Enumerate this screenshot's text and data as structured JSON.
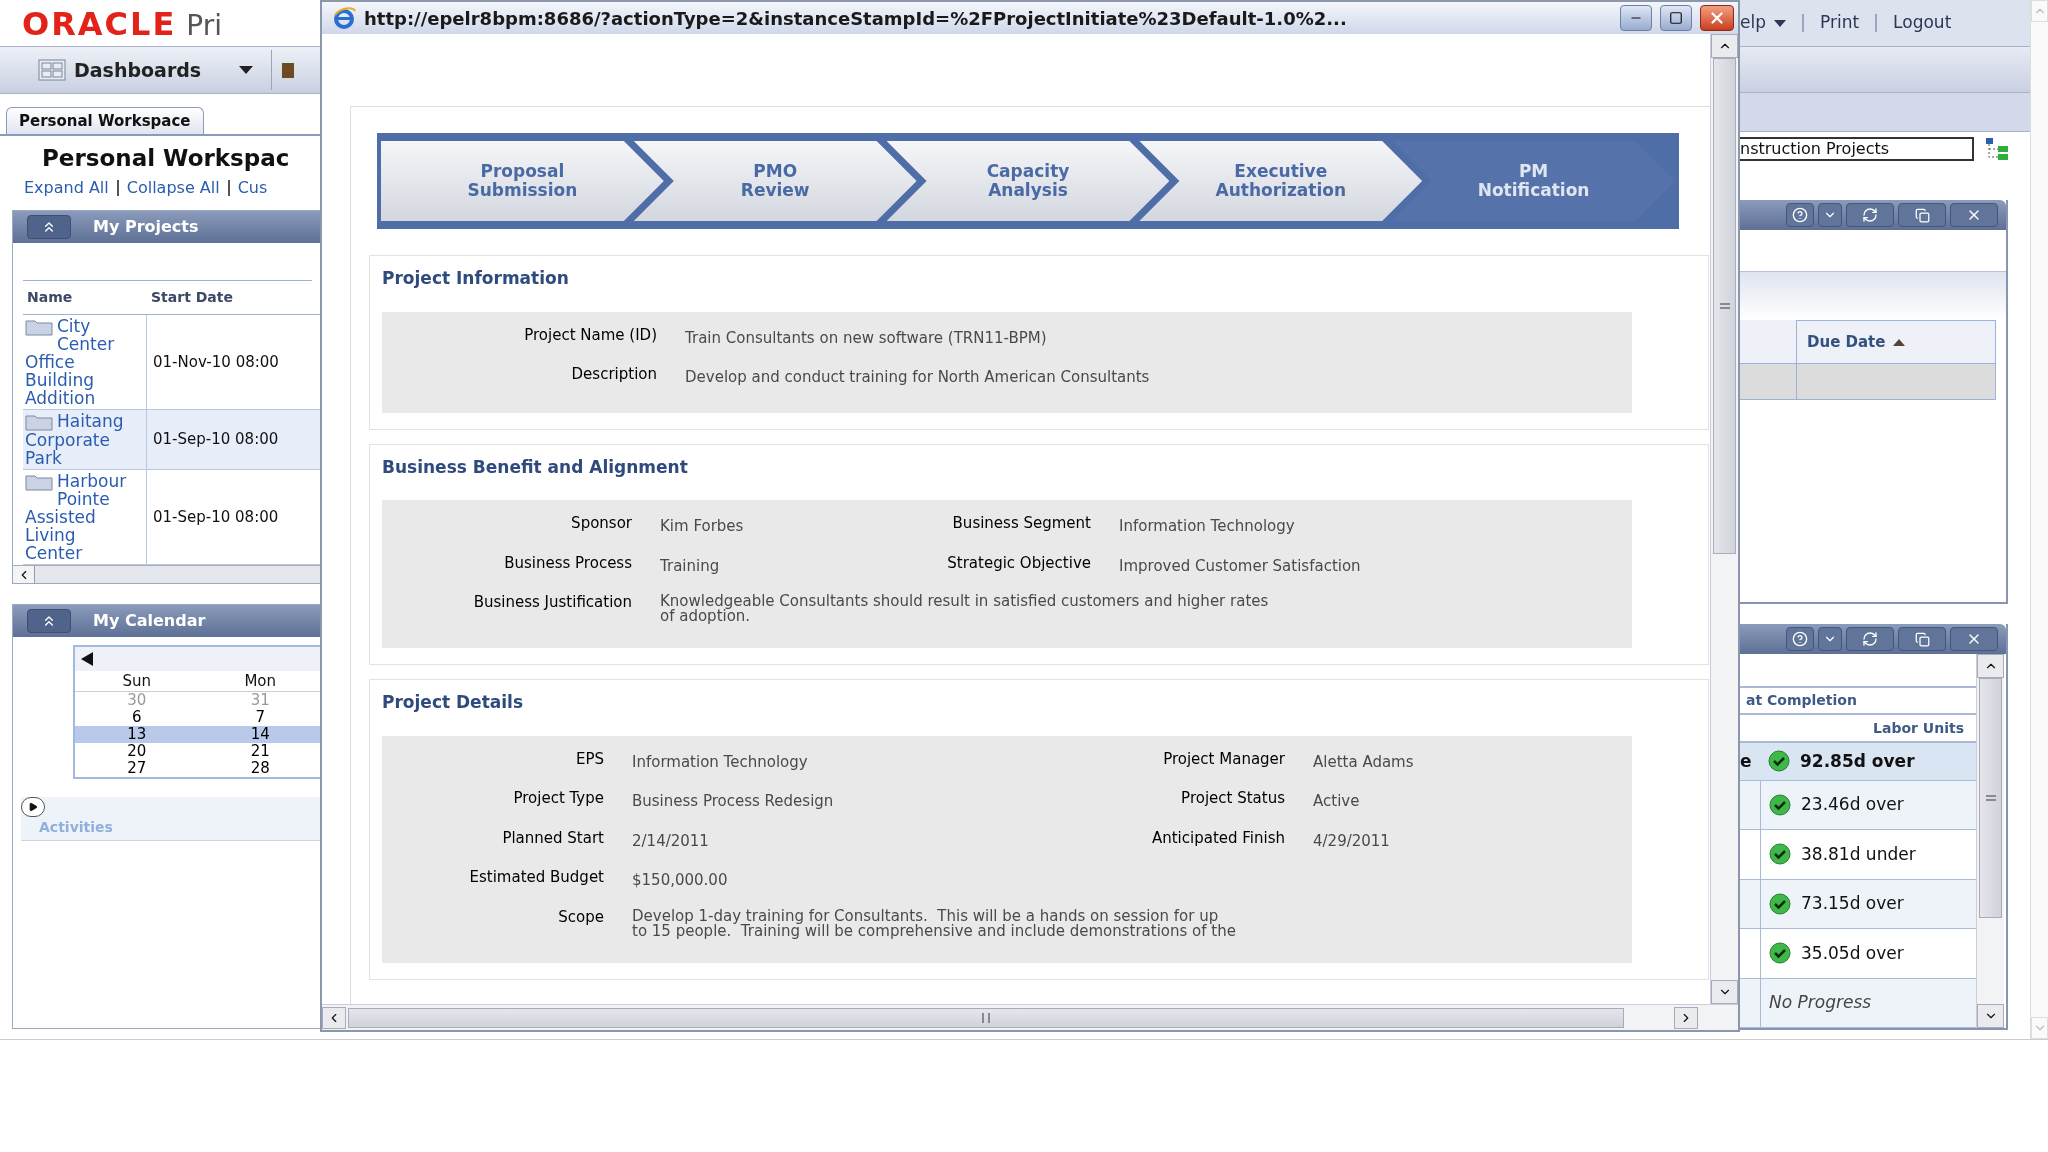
{
  "app": {
    "logo": "ORACLE",
    "product": "Pri",
    "menu": {
      "label": "Dashboards"
    },
    "top_links": [
      {
        "label": "elp",
        "has_menu": true
      },
      {
        "label": "Print",
        "has_menu": false
      },
      {
        "label": "Logout",
        "has_menu": false
      }
    ]
  },
  "workspace_tab": {
    "label": "Personal Workspace"
  },
  "page_title": "Personal Workspac",
  "page_links": [
    "Expand All",
    "Collapse All",
    "Cus"
  ],
  "project_filter": {
    "value": "nstruction Projects"
  },
  "my_projects": {
    "title": "My Projects",
    "columns": [
      "Name",
      "Start Date"
    ],
    "rows": [
      {
        "name": "City Center Office Building Addition",
        "start_date": "01-Nov-10 08:00"
      },
      {
        "name": "Haitang Corporate Park",
        "start_date": "01-Sep-10 08:00"
      },
      {
        "name": "Harbour Pointe Assisted Living Center",
        "start_date": "01-Sep-10 08:00"
      }
    ]
  },
  "my_calendar": {
    "title": "My Calendar",
    "days": [
      "Sun",
      "Mon"
    ],
    "weeks": [
      {
        "selected": false,
        "dates": [
          {
            "label": "30",
            "other_month": true
          },
          {
            "label": "31",
            "other_month": true
          }
        ]
      },
      {
        "selected": false,
        "dates": [
          {
            "label": "6",
            "other_month": false
          },
          {
            "label": "7",
            "other_month": false
          }
        ]
      },
      {
        "selected": true,
        "dates": [
          {
            "label": "13",
            "other_month": false
          },
          {
            "label": "14",
            "other_month": false
          }
        ]
      },
      {
        "selected": false,
        "dates": [
          {
            "label": "20",
            "other_month": false
          },
          {
            "label": "21",
            "other_month": false
          }
        ]
      },
      {
        "selected": false,
        "dates": [
          {
            "label": "27",
            "other_month": false
          },
          {
            "label": "28",
            "other_month": false
          }
        ]
      }
    ]
  },
  "activities": {
    "label": "Activities",
    "expanded": false
  },
  "portlet_1": {
    "columns": [
      {
        "label": "Due Date",
        "sorted_ascending": true
      }
    ]
  },
  "portlet_2": {
    "header": "at Completion",
    "subheader": "Labor Units",
    "rows": [
      {
        "lead": "e",
        "value": "92.85d over",
        "kind": "ok",
        "selected": true
      },
      {
        "value": "23.46d over",
        "kind": "ok",
        "selected": false
      },
      {
        "value": "38.81d under",
        "kind": "ok",
        "selected": false
      },
      {
        "value": "73.15d over",
        "kind": "ok",
        "selected": false
      },
      {
        "value": "35.05d over",
        "kind": "ok",
        "selected": false
      },
      {
        "value": "No Progress",
        "kind": "empty",
        "selected": false
      }
    ]
  },
  "popup": {
    "title": "http://epelr8bpm:8686/?actionType=2&instanceStampId=%2FProjectInitiate%23Default-1.0%2...",
    "steps": [
      {
        "lines": [
          "Proposal",
          "Submission"
        ],
        "selected": false
      },
      {
        "lines": [
          "PMO",
          "Review"
        ],
        "selected": false
      },
      {
        "lines": [
          "Capacity",
          "Analysis"
        ],
        "selected": false
      },
      {
        "lines": [
          "Executive",
          "Authorization"
        ],
        "selected": false
      },
      {
        "lines": [
          "PM",
          "Notification"
        ],
        "selected": true
      }
    ],
    "sections": [
      {
        "title": "Project Information",
        "kind": "info",
        "rows": [
          [
            {
              "label": "Project Name (ID)",
              "value": "Train Consultants on new software (TRN11-BPM)"
            }
          ],
          [
            {
              "label": "Description",
              "value": "Develop and conduct training for North American Consultants"
            }
          ]
        ]
      },
      {
        "title": "Business Benefit and Alignment",
        "kind": "benefit",
        "rows": [
          [
            {
              "label": "Sponsor",
              "value": "Kim Forbes"
            },
            {
              "label": "Business Segment",
              "value": "Information Technology"
            }
          ],
          [
            {
              "label": "Business Process",
              "value": "Training"
            },
            {
              "label": "Strategic Objective",
              "value": "Improved Customer Satisfaction"
            }
          ],
          [
            {
              "label": "Business Justification",
              "lines": [
                "Knowledgeable Consultants should result in satisfied customers and higher rates",
                "of adoption."
              ]
            }
          ]
        ]
      },
      {
        "title": "Project Details",
        "kind": "details",
        "rows": [
          [
            {
              "label": "EPS",
              "value": "Information Technology"
            },
            {
              "label": "Project Manager",
              "value": "Aletta Adams"
            }
          ],
          [
            {
              "label": "Project Type",
              "value": "Business Process Redesign"
            },
            {
              "label": "Project Status",
              "value": "Active"
            }
          ],
          [
            {
              "label": "Planned Start",
              "value": "2/14/2011"
            },
            {
              "label": "Anticipated Finish",
              "value": "4/29/2011"
            }
          ],
          [
            {
              "label": "Estimated Budget",
              "value": "$150,000.00"
            }
          ],
          [
            {
              "label": "Scope",
              "lines": [
                "Develop 1-day training for Consultants.  This will be a hands on session for up",
                "to 15 people.  Training will be comprehensive and include demonstrations of the"
              ]
            }
          ]
        ]
      }
    ]
  }
}
